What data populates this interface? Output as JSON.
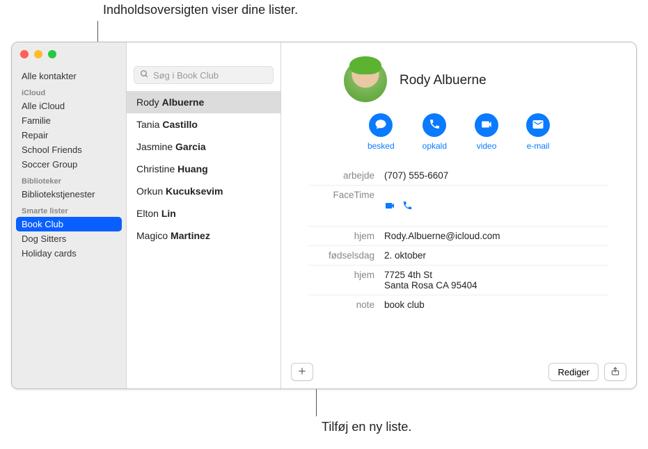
{
  "callouts": {
    "top": "Indholdsoversigten viser dine lister.",
    "bottom": "Tilføj en ny liste."
  },
  "sidebar": {
    "all": "Alle kontakter",
    "groups": [
      {
        "header": "iCloud",
        "items": [
          "Alle iCloud",
          "Familie",
          "Repair",
          "School Friends",
          "Soccer Group"
        ]
      },
      {
        "header": "Biblioteker",
        "items": [
          "Bibliotekstjenester"
        ]
      },
      {
        "header": "Smarte lister",
        "items": [
          "Book Club",
          "Dog Sitters",
          "Holiday cards"
        ]
      }
    ],
    "selected": "Book Club"
  },
  "search": {
    "placeholder": "Søg i Book Club"
  },
  "contacts": [
    {
      "first": "Rody",
      "last": "Albuerne",
      "selected": true
    },
    {
      "first": "Tania",
      "last": "Castillo"
    },
    {
      "first": "Jasmine",
      "last": "Garcia"
    },
    {
      "first": "Christine",
      "last": "Huang"
    },
    {
      "first": "Orkun",
      "last": "Kucuksevim"
    },
    {
      "first": "Elton",
      "last": "Lin"
    },
    {
      "first": "Magico",
      "last": "Martinez"
    }
  ],
  "card": {
    "name": "Rody Albuerne",
    "actions": {
      "message": "besked",
      "call": "opkald",
      "video": "video",
      "mail": "e-mail"
    },
    "fields": {
      "work_label": "arbejde",
      "work_value": "(707) 555-6607",
      "facetime_label": "FaceTime",
      "home_email_label": "hjem",
      "home_email_value": "Rody.Albuerne@icloud.com",
      "birthday_label": "fødselsdag",
      "birthday_value": "2. oktober",
      "home_addr_label": "hjem",
      "home_addr_value": "7725 4th St\nSanta Rosa CA 95404",
      "note_label": "note",
      "note_value": "book club"
    }
  },
  "buttons": {
    "edit": "Rediger"
  }
}
